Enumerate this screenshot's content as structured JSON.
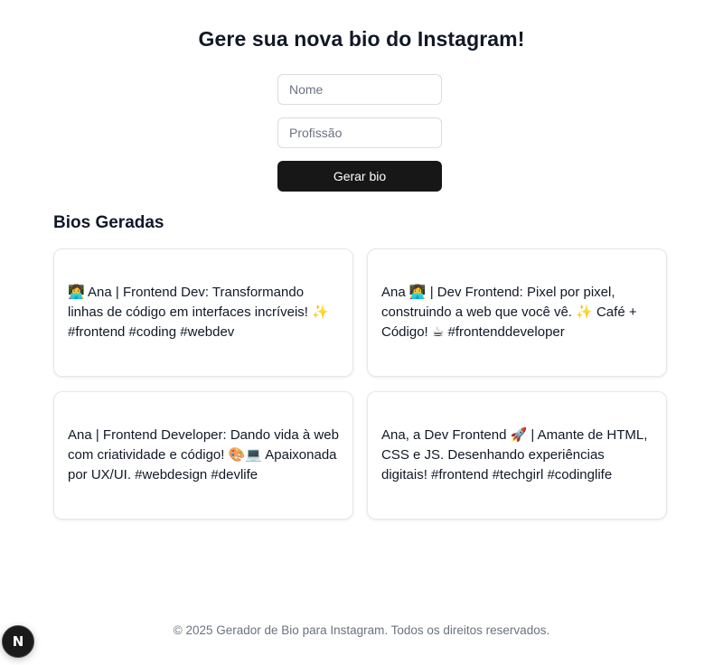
{
  "header": {
    "title": "Gere sua nova bio do Instagram!"
  },
  "form": {
    "name_placeholder": "Nome",
    "profession_placeholder": "Profissão",
    "submit_label": "Gerar bio"
  },
  "bios": {
    "section_title": "Bios Geradas",
    "items": [
      "👩‍💻 Ana | Frontend Dev: Transformando linhas de código em interfaces incríveis! ✨ #frontend #coding #webdev",
      "Ana 👩‍💻 | Dev Frontend: Pixel por pixel, construindo a web que você vê. ✨ Café + Código! ☕ #frontenddeveloper",
      "Ana | Frontend Developer: Dando vida à web com criatividade e código! 🎨💻 Apaixonada por UX/UI. #webdesign #devlife",
      "Ana, a Dev Frontend 🚀 | Amante de HTML, CSS e JS. Desenhando experiências digitais! #frontend #techgirl #codinglife"
    ]
  },
  "footer": {
    "text": "© 2025 Gerador de Bio para Instagram. Todos os direitos reservados."
  },
  "dev_badge": {
    "letter": "N",
    "icon": "nextjs-icon"
  },
  "colors": {
    "button_bg": "#171717",
    "text": "#111827",
    "muted": "#6b7280",
    "border": "#e5e7eb"
  }
}
